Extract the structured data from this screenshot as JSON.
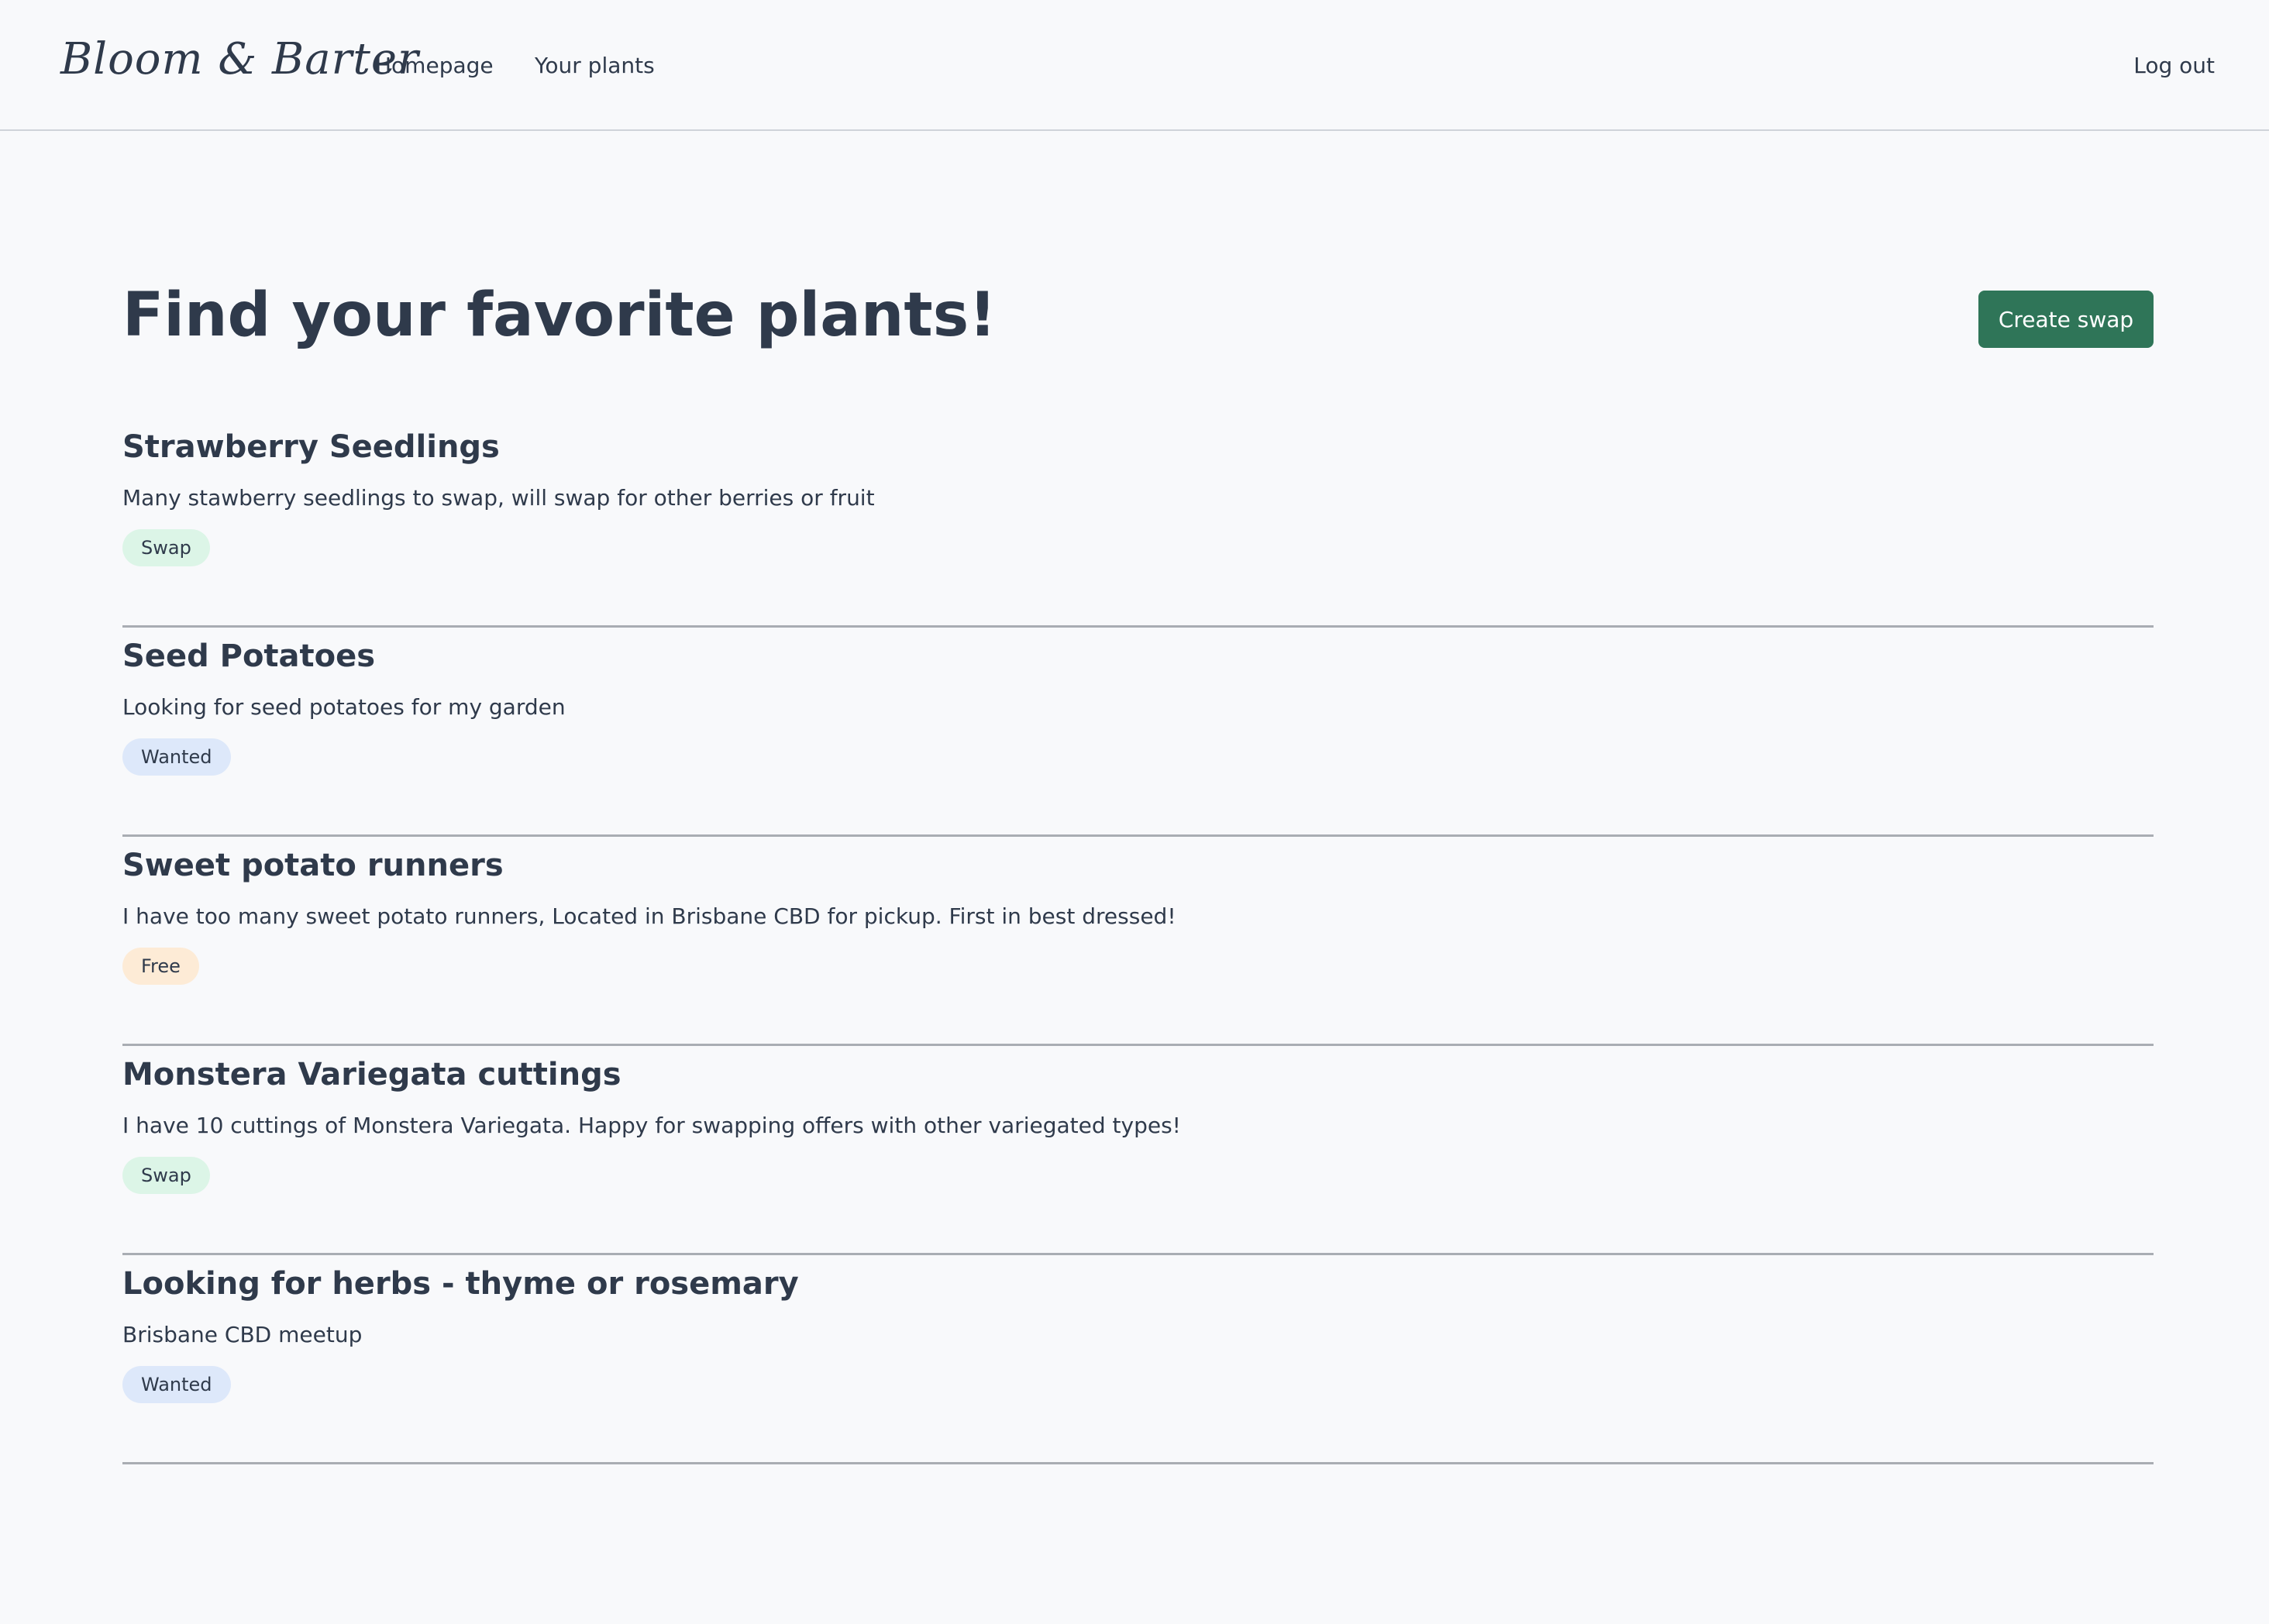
{
  "header": {
    "logo": "Bloom & Barter",
    "nav": {
      "homepage": "Homepage",
      "your_plants": "Your plants",
      "logout": "Log out"
    }
  },
  "main": {
    "title": "Find your favorite plants!",
    "create_button": "Create swap",
    "listings": [
      {
        "title": "Strawberry Seedlings",
        "description": "Many stawberry seedlings to swap, will swap for other berries or fruit",
        "tag": "Swap"
      },
      {
        "title": "Seed Potatoes",
        "description": "Looking for seed potatoes for my garden",
        "tag": "Wanted"
      },
      {
        "title": "Sweet potato runners",
        "description": "I have too many sweet potato runners, Located in Brisbane CBD for pickup. First in best dressed!",
        "tag": "Free"
      },
      {
        "title": "Monstera Variegata cuttings",
        "description": "I have 10 cuttings of Monstera Variegata. Happy for swapping offers with other variegated types!",
        "tag": "Swap"
      },
      {
        "title": "Looking for herbs - thyme or rosemary",
        "description": "Brisbane CBD meetup",
        "tag": "Wanted"
      }
    ]
  },
  "colors": {
    "background": "#f8f9fb",
    "text": "#2f3a4b",
    "primary_button": "#2f7558",
    "swap_badge": "#dcf5e7",
    "wanted_badge": "#dde8fa",
    "free_badge": "#fdebd6"
  }
}
